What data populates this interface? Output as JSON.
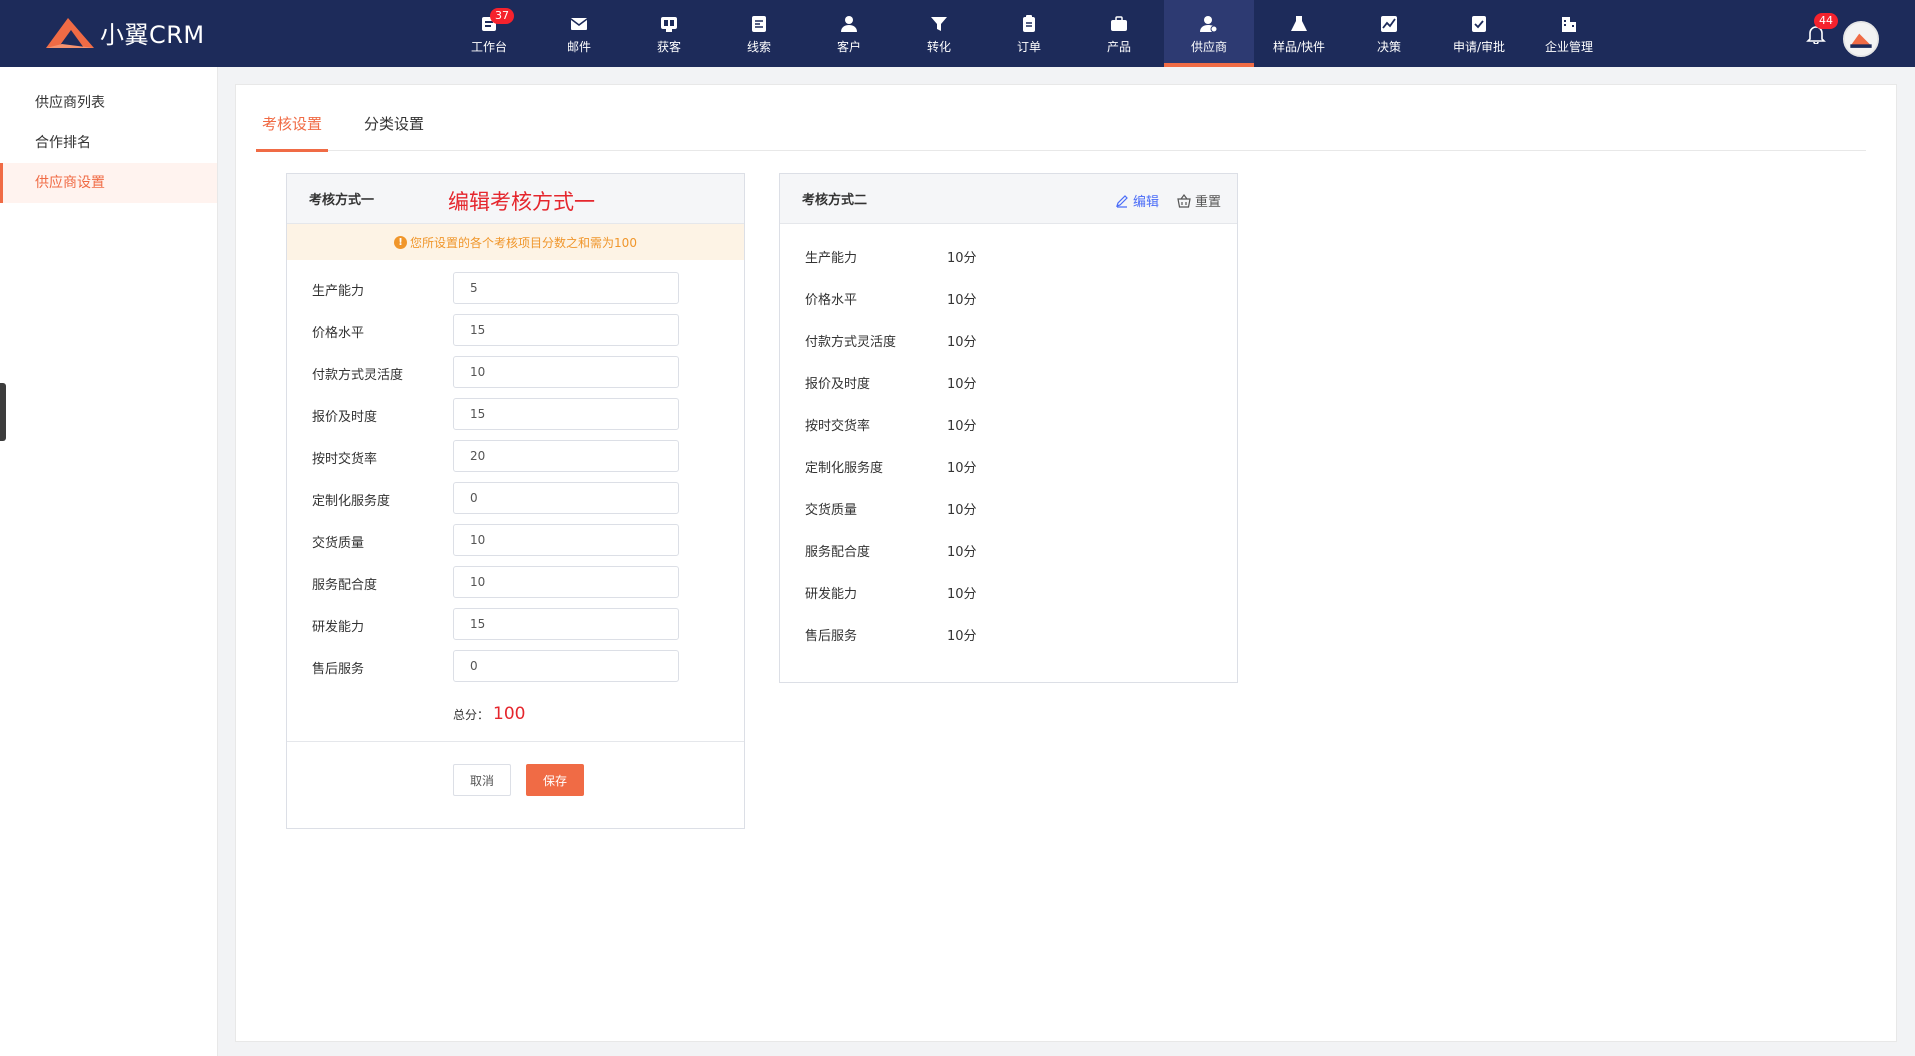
{
  "app": {
    "logo_text": "小翼CRM"
  },
  "nav": {
    "items": [
      {
        "key": "workbench",
        "label": "工作台",
        "badge": "37"
      },
      {
        "key": "mail",
        "label": "邮件"
      },
      {
        "key": "acquire",
        "label": "获客"
      },
      {
        "key": "leads",
        "label": "线索"
      },
      {
        "key": "customer",
        "label": "客户"
      },
      {
        "key": "convert",
        "label": "转化"
      },
      {
        "key": "order",
        "label": "订单"
      },
      {
        "key": "product",
        "label": "产品"
      },
      {
        "key": "supplier",
        "label": "供应商",
        "active": true
      },
      {
        "key": "sample",
        "label": "样品/快件"
      },
      {
        "key": "decision",
        "label": "决策"
      },
      {
        "key": "approval",
        "label": "申请/审批"
      },
      {
        "key": "company",
        "label": "企业管理"
      }
    ],
    "bell_badge": "44"
  },
  "sidebar": {
    "items": [
      {
        "label": "供应商列表"
      },
      {
        "label": "合作排名"
      },
      {
        "label": "供应商设置",
        "active": true
      }
    ]
  },
  "tabs": [
    {
      "label": "考核设置",
      "active": true
    },
    {
      "label": "分类设置"
    }
  ],
  "method_one": {
    "title": "考核方式一",
    "edit_heading": "编辑考核方式一",
    "notice": "您所设置的各个考核项目分数之和需为100",
    "fields": [
      {
        "label": "生产能力",
        "value": "5"
      },
      {
        "label": "价格水平",
        "value": "15"
      },
      {
        "label": "付款方式灵活度",
        "value": "10"
      },
      {
        "label": "报价及时度",
        "value": "15"
      },
      {
        "label": "按时交货率",
        "value": "20"
      },
      {
        "label": "定制化服务度",
        "value": "0"
      },
      {
        "label": "交货质量",
        "value": "10"
      },
      {
        "label": "服务配合度",
        "value": "10"
      },
      {
        "label": "研发能力",
        "value": "15"
      },
      {
        "label": "售后服务",
        "value": "0"
      }
    ],
    "total_label": "总分：",
    "total_value": "100",
    "cancel_label": "取消",
    "save_label": "保存"
  },
  "method_two": {
    "title": "考核方式二",
    "edit_label": "编辑",
    "reset_label": "重置",
    "items": [
      {
        "label": "生产能力",
        "value": "10分"
      },
      {
        "label": "价格水平",
        "value": "10分"
      },
      {
        "label": "付款方式灵活度",
        "value": "10分"
      },
      {
        "label": "报价及时度",
        "value": "10分"
      },
      {
        "label": "按时交货率",
        "value": "10分"
      },
      {
        "label": "定制化服务度",
        "value": "10分"
      },
      {
        "label": "交货质量",
        "value": "10分"
      },
      {
        "label": "服务配合度",
        "value": "10分"
      },
      {
        "label": "研发能力",
        "value": "10分"
      },
      {
        "label": "售后服务",
        "value": "10分"
      }
    ]
  },
  "colors": {
    "nav_bg": "#1d2b5a",
    "accent": "#f06b45",
    "danger": "#e5262d",
    "link": "#4a6cf7",
    "notice_text": "#f0962b"
  }
}
